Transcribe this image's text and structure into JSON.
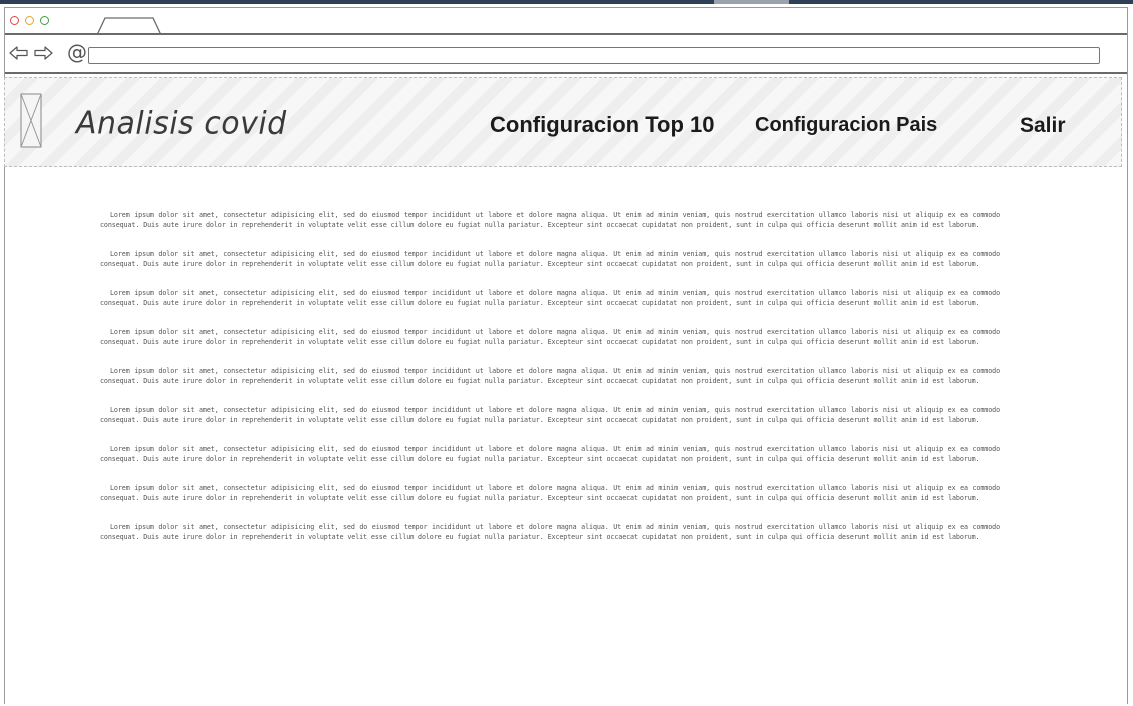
{
  "app": {
    "title": "Analisis covid"
  },
  "browser": {
    "address_value": ""
  },
  "nav": {
    "items": [
      {
        "label": "Configuracion Top 10"
      },
      {
        "label": "Configuracion Pais"
      },
      {
        "label": "Salir"
      }
    ]
  },
  "content": {
    "paragraphs": [
      "Lorem ipsum dolor sit amet, consectetur adipisicing elit, sed do eiusmod tempor incididunt ut labore et dolore magna aliqua. Ut enim ad minim veniam, quis nostrud exercitation ullamco laboris nisi ut aliquip ex ea commodo consequat. Duis aute irure dolor in reprehenderit in voluptate velit esse cillum dolore eu fugiat nulla pariatur. Excepteur sint occaecat cupidatat non proident, sunt in culpa qui officia deserunt mollit anim id est laborum.",
      "Lorem ipsum dolor sit amet, consectetur adipisicing elit, sed do eiusmod tempor incididunt ut labore et dolore magna aliqua. Ut enim ad minim veniam, quis nostrud exercitation ullamco laboris nisi ut aliquip ex ea commodo consequat. Duis aute irure dolor in reprehenderit in voluptate velit esse cillum dolore eu fugiat nulla pariatur. Excepteur sint occaecat cupidatat non proident, sunt in culpa qui officia deserunt mollit anim id est laborum.",
      "Lorem ipsum dolor sit amet, consectetur adipisicing elit, sed do eiusmod tempor incididunt ut labore et dolore magna aliqua. Ut enim ad minim veniam, quis nostrud exercitation ullamco laboris nisi ut aliquip ex ea commodo consequat. Duis aute irure dolor in reprehenderit in voluptate velit esse cillum dolore eu fugiat nulla pariatur. Excepteur sint occaecat cupidatat non proident, sunt in culpa qui officia deserunt mollit anim id est laborum.",
      "Lorem ipsum dolor sit amet, consectetur adipisicing elit, sed do eiusmod tempor incididunt ut labore et dolore magna aliqua. Ut enim ad minim veniam, quis nostrud exercitation ullamco laboris nisi ut aliquip ex ea commodo consequat. Duis aute irure dolor in reprehenderit in voluptate velit esse cillum dolore eu fugiat nulla pariatur. Excepteur sint occaecat cupidatat non proident, sunt in culpa qui officia deserunt mollit anim id est laborum.",
      "Lorem ipsum dolor sit amet, consectetur adipisicing elit, sed do eiusmod tempor incididunt ut labore et dolore magna aliqua. Ut enim ad minim veniam, quis nostrud exercitation ullamco laboris nisi ut aliquip ex ea commodo consequat. Duis aute irure dolor in reprehenderit in voluptate velit esse cillum dolore eu fugiat nulla pariatur. Excepteur sint occaecat cupidatat non proident, sunt in culpa qui officia deserunt mollit anim id est laborum.",
      "Lorem ipsum dolor sit amet, consectetur adipisicing elit, sed do eiusmod tempor incididunt ut labore et dolore magna aliqua. Ut enim ad minim veniam, quis nostrud exercitation ullamco laboris nisi ut aliquip ex ea commodo consequat. Duis aute irure dolor in reprehenderit in voluptate velit esse cillum dolore eu fugiat nulla pariatur. Excepteur sint occaecat cupidatat non proident, sunt in culpa qui officia deserunt mollit anim id est laborum.",
      "Lorem ipsum dolor sit amet, consectetur adipisicing elit, sed do eiusmod tempor incididunt ut labore et dolore magna aliqua. Ut enim ad minim veniam, quis nostrud exercitation ullamco laboris nisi ut aliquip ex ea commodo consequat. Duis aute irure dolor in reprehenderit in voluptate velit esse cillum dolore eu fugiat nulla pariatur. Excepteur sint occaecat cupidatat non proident, sunt in culpa qui officia deserunt mollit anim id est laborum.",
      "Lorem ipsum dolor sit amet, consectetur adipisicing elit, sed do eiusmod tempor incididunt ut labore et dolore magna aliqua. Ut enim ad minim veniam, quis nostrud exercitation ullamco laboris nisi ut aliquip ex ea commodo consequat. Duis aute irure dolor in reprehenderit in voluptate velit esse cillum dolore eu fugiat nulla pariatur. Excepteur sint occaecat cupidatat non proident, sunt in culpa qui officia deserunt mollit anim id est laborum.",
      "Lorem ipsum dolor sit amet, consectetur adipisicing elit, sed do eiusmod tempor incididunt ut labore et dolore magna aliqua. Ut enim ad minim veniam, quis nostrud exercitation ullamco laboris nisi ut aliquip ex ea commodo consequat. Duis aute irure dolor in reprehenderit in voluptate velit esse cillum dolore eu fugiat nulla pariatur. Excepteur sint occaecat cupidatat non proident, sunt in culpa qui officia deserunt mollit anim id est laborum."
    ]
  },
  "icons": {
    "window_close": "circle-red-icon",
    "window_minimize": "circle-yellow-icon",
    "window_maximize": "circle-green-icon",
    "back": "arrow-left-icon",
    "forward": "arrow-right-icon",
    "address": "at-sign-icon",
    "logo": "image-placeholder-icon"
  }
}
